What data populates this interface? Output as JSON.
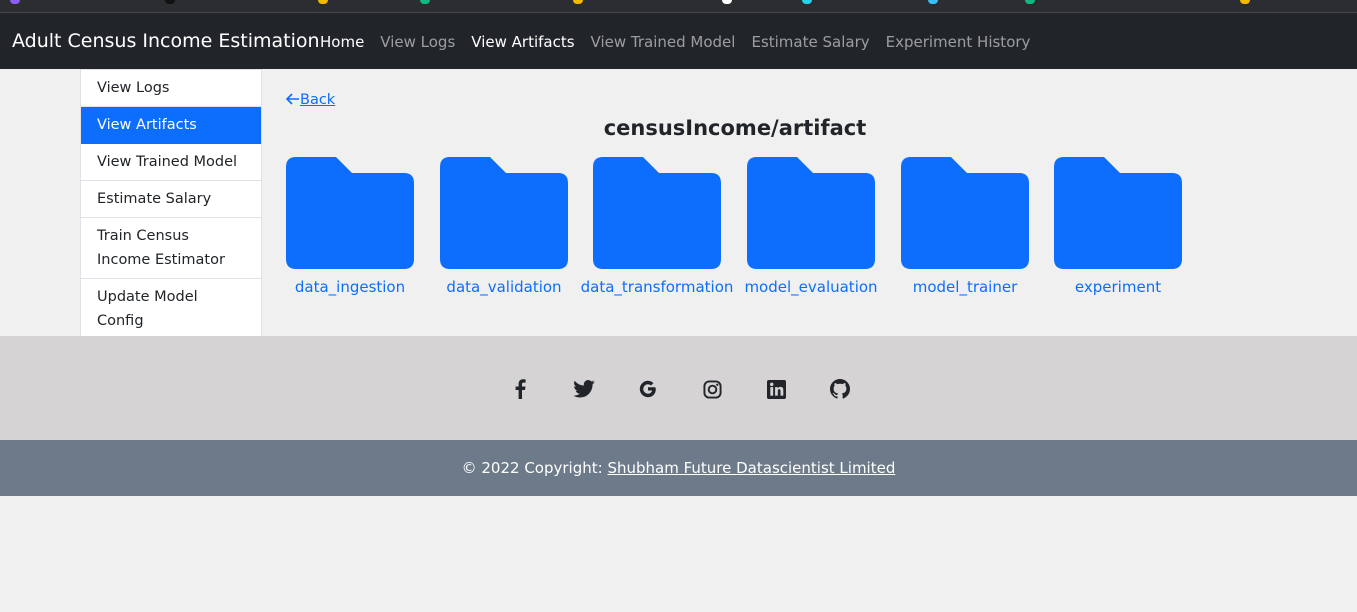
{
  "navbar": {
    "brand": "Adult Census Income Estimation",
    "links": [
      {
        "label": "Home",
        "active": true
      },
      {
        "label": "View Logs",
        "active": false
      },
      {
        "label": "View Artifacts",
        "active": true
      },
      {
        "label": "View Trained Model",
        "active": false
      },
      {
        "label": "Estimate Salary",
        "active": false
      },
      {
        "label": "Experiment History",
        "active": false
      }
    ]
  },
  "sidebar": {
    "items": [
      {
        "label": "View Logs"
      },
      {
        "label": "View Artifacts",
        "active": true
      },
      {
        "label": "View Trained Model"
      },
      {
        "label": "Estimate Salary"
      },
      {
        "label": "Train Census Income Estimator"
      },
      {
        "label": "Update Model Config"
      }
    ]
  },
  "main": {
    "back_label": "Back",
    "path_title": "censusIncome/artifact",
    "folders": [
      {
        "name": "data_ingestion"
      },
      {
        "name": "data_validation"
      },
      {
        "name": "data_transformation"
      },
      {
        "name": "model_evaluation"
      },
      {
        "name": "model_trainer"
      },
      {
        "name": "experiment"
      }
    ],
    "folder_color": "#0d6efd"
  },
  "footer": {
    "social_icons": [
      "facebook-icon",
      "twitter-icon",
      "google-icon",
      "instagram-icon",
      "linkedin-icon",
      "github-icon"
    ],
    "copyright_prefix": "© 2022 Copyright: ",
    "copyright_link": "Shubham Future Datascientist Limited"
  },
  "colors": {
    "navbar_bg": "#212529",
    "accent": "#0d6efd",
    "social_bg": "#d5d3d4",
    "copyright_bg": "#6c7a89"
  }
}
